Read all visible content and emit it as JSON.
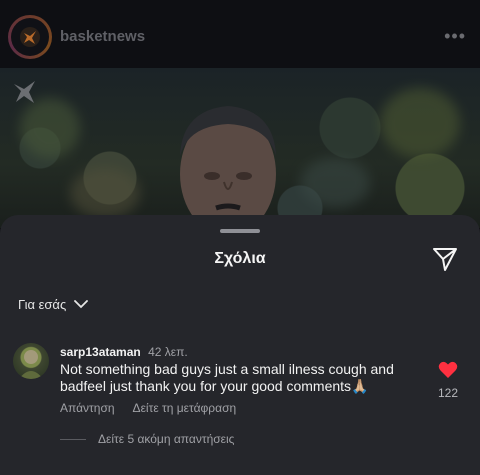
{
  "post": {
    "account_name": "basketnews"
  },
  "sheet": {
    "title": "Σχόλια",
    "filter_label": "Για εσάς"
  },
  "comment": {
    "username": "sarp13ataman",
    "time": "42 λεπ.",
    "text": "Not something bad guys just a small ilness cough and badfeel just thank you for your good comments🙏🏼",
    "reply_label": "Απάντηση",
    "translate_label": "Δείτε τη μετάφραση",
    "like_count": "122",
    "view_replies_label": "Δείτε 5 ακόμη απαντήσεις"
  },
  "colors": {
    "sheet_bg": "#25262b",
    "like_red": "#ff3040"
  }
}
